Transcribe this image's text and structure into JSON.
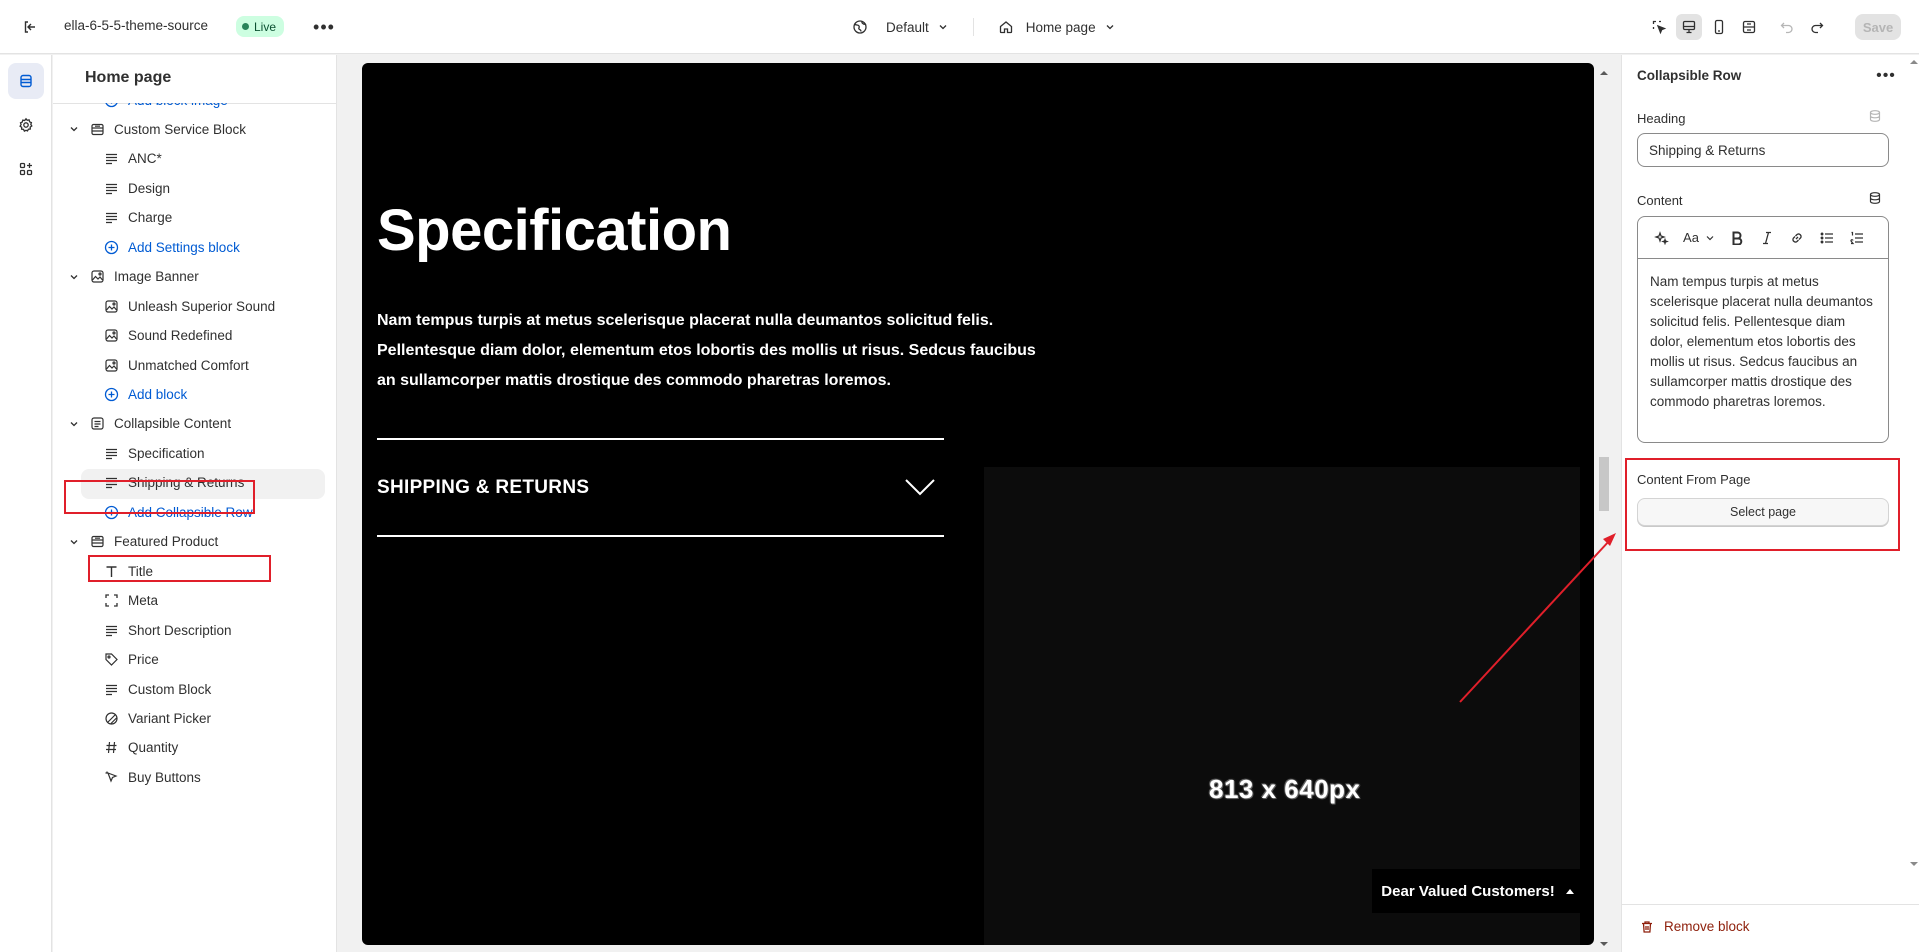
{
  "topbar": {
    "theme_name": "ella-6-5-5-theme-source",
    "status": "Live",
    "more": "•••",
    "template": "Default",
    "page": "Home page",
    "save": "Save"
  },
  "sidebar": {
    "title": "Home page",
    "rows": [
      {
        "kind": "add",
        "label": "Add block image",
        "icon": "plus-circle-icon"
      },
      {
        "kind": "section",
        "label": "Custom Service Block",
        "icon": "section-icon"
      },
      {
        "kind": "block",
        "label": "ANC*",
        "icon": "text-icon"
      },
      {
        "kind": "block",
        "label": "Design",
        "icon": "text-icon"
      },
      {
        "kind": "block",
        "label": "Charge",
        "icon": "text-icon"
      },
      {
        "kind": "add",
        "label": "Add Settings block",
        "icon": "plus-circle-icon"
      },
      {
        "kind": "section",
        "label": "Image Banner",
        "icon": "image-icon"
      },
      {
        "kind": "block",
        "label": "Unleash Superior Sound",
        "icon": "image-icon"
      },
      {
        "kind": "block",
        "label": "Sound Redefined",
        "icon": "image-icon"
      },
      {
        "kind": "block",
        "label": "Unmatched Comfort",
        "icon": "image-icon"
      },
      {
        "kind": "add",
        "label": "Add block",
        "icon": "plus-circle-icon"
      },
      {
        "kind": "section",
        "label": "Collapsible Content",
        "icon": "collapsible-icon"
      },
      {
        "kind": "block",
        "label": "Specification",
        "icon": "text-icon"
      },
      {
        "kind": "block",
        "label": "Shipping & Returns",
        "icon": "text-icon",
        "selected": true
      },
      {
        "kind": "add",
        "label": "Add Collapsible Row",
        "icon": "plus-circle-icon"
      },
      {
        "kind": "section",
        "label": "Featured Product",
        "icon": "section-icon"
      },
      {
        "kind": "block",
        "label": "Title",
        "icon": "title-icon"
      },
      {
        "kind": "block",
        "label": "Meta",
        "icon": "dashed-square-icon"
      },
      {
        "kind": "block",
        "label": "Short Description",
        "icon": "text-icon"
      },
      {
        "kind": "block",
        "label": "Price",
        "icon": "tag-icon"
      },
      {
        "kind": "block",
        "label": "Custom Block",
        "icon": "text-icon"
      },
      {
        "kind": "block",
        "label": "Variant Picker",
        "icon": "variant-icon"
      },
      {
        "kind": "block",
        "label": "Quantity",
        "icon": "hash-icon"
      },
      {
        "kind": "block",
        "label": "Buy Buttons",
        "icon": "cursor-icon"
      }
    ]
  },
  "preview": {
    "heading": "Specification",
    "body": "Nam tempus turpis at metus scelerisque placerat nulla deumantos solicitud felis. Pellentesque diam dolor, elementum etos lobortis des mollis ut risus. Sedcus faucibus an sullamcorper mattis drostique des commodo pharetras loremos.",
    "collapsible_title": "SHIPPING & RETURNS",
    "image_placeholder": "813 x 640px",
    "toast": "Dear Valued Customers!"
  },
  "settings": {
    "title": "Collapsible Row",
    "heading_label": "Heading",
    "heading_value": "Shipping & Returns",
    "content_label": "Content",
    "toolbar_text_style": "Aa",
    "content_value": "Nam tempus turpis at metus scelerisque placerat nulla deumantos solicitud felis. Pellentesque diam dolor, elementum etos lobortis des mollis ut risus. Sedcus faucibus an sullamcorper mattis drostique des commodo pharetras loremos.",
    "content_from_page_label": "Content From Page",
    "select_page": "Select page",
    "remove_block": "Remove block"
  },
  "colors": {
    "accent_blue": "#005bd3",
    "annotation_red": "#e01f2a",
    "live_badge_bg": "#cdfee1",
    "preview_bg": "#000000"
  }
}
